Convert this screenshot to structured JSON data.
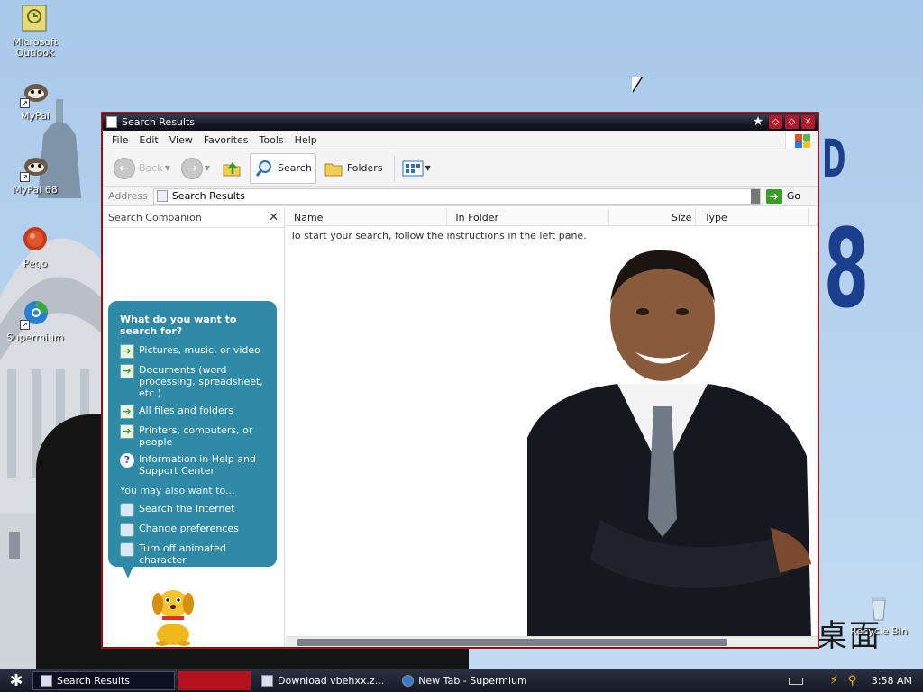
{
  "desktop": {
    "icons": [
      {
        "label": "Microsoft Outlook",
        "icon": "outlook-icon"
      },
      {
        "label": "MyPal",
        "icon": "mypal-icon"
      },
      {
        "label": "MyPal 68",
        "icon": "mypal-icon"
      },
      {
        "label": "Pego",
        "icon": "pego-icon"
      },
      {
        "label": "Supermium",
        "icon": "supermium-icon"
      }
    ],
    "recycle_bin": "Recycle Bin",
    "wallpaper_letters": [
      "D",
      "8"
    ],
    "wallpaper_signature": "法桌面"
  },
  "window": {
    "title": "Search Results",
    "menu": [
      "File",
      "Edit",
      "View",
      "Favorites",
      "Tools",
      "Help"
    ],
    "toolbar": {
      "back": "Back",
      "search": "Search",
      "folders": "Folders"
    },
    "address": {
      "label": "Address",
      "value": "Search Results",
      "go": "Go"
    },
    "companion": {
      "title": "Search Companion",
      "question": "What do you want to search for?",
      "options": [
        "Pictures, music, or video",
        "Documents (word processing, spreadsheet, etc.)",
        "All files and folders",
        "Printers, computers, or people",
        "Information in Help and Support Center"
      ],
      "also_label": "You may also want to...",
      "also": [
        "Search the Internet",
        "Change preferences",
        "Turn off animated character"
      ]
    },
    "columns": [
      "Name",
      "In Folder",
      "Size",
      "Type"
    ],
    "message": "To start your search, follow the instructions in the left pane."
  },
  "taskbar": {
    "tasks": [
      "Search Results",
      "Download vbehxx.z...",
      "New Tab - Supermium"
    ],
    "clock": "3:58 AM"
  },
  "colors": {
    "title_bar": "#171b27",
    "companion_bubble": "#2e8aa6",
    "taskbar": "#1d2231",
    "accent_red": "#b4121d"
  }
}
